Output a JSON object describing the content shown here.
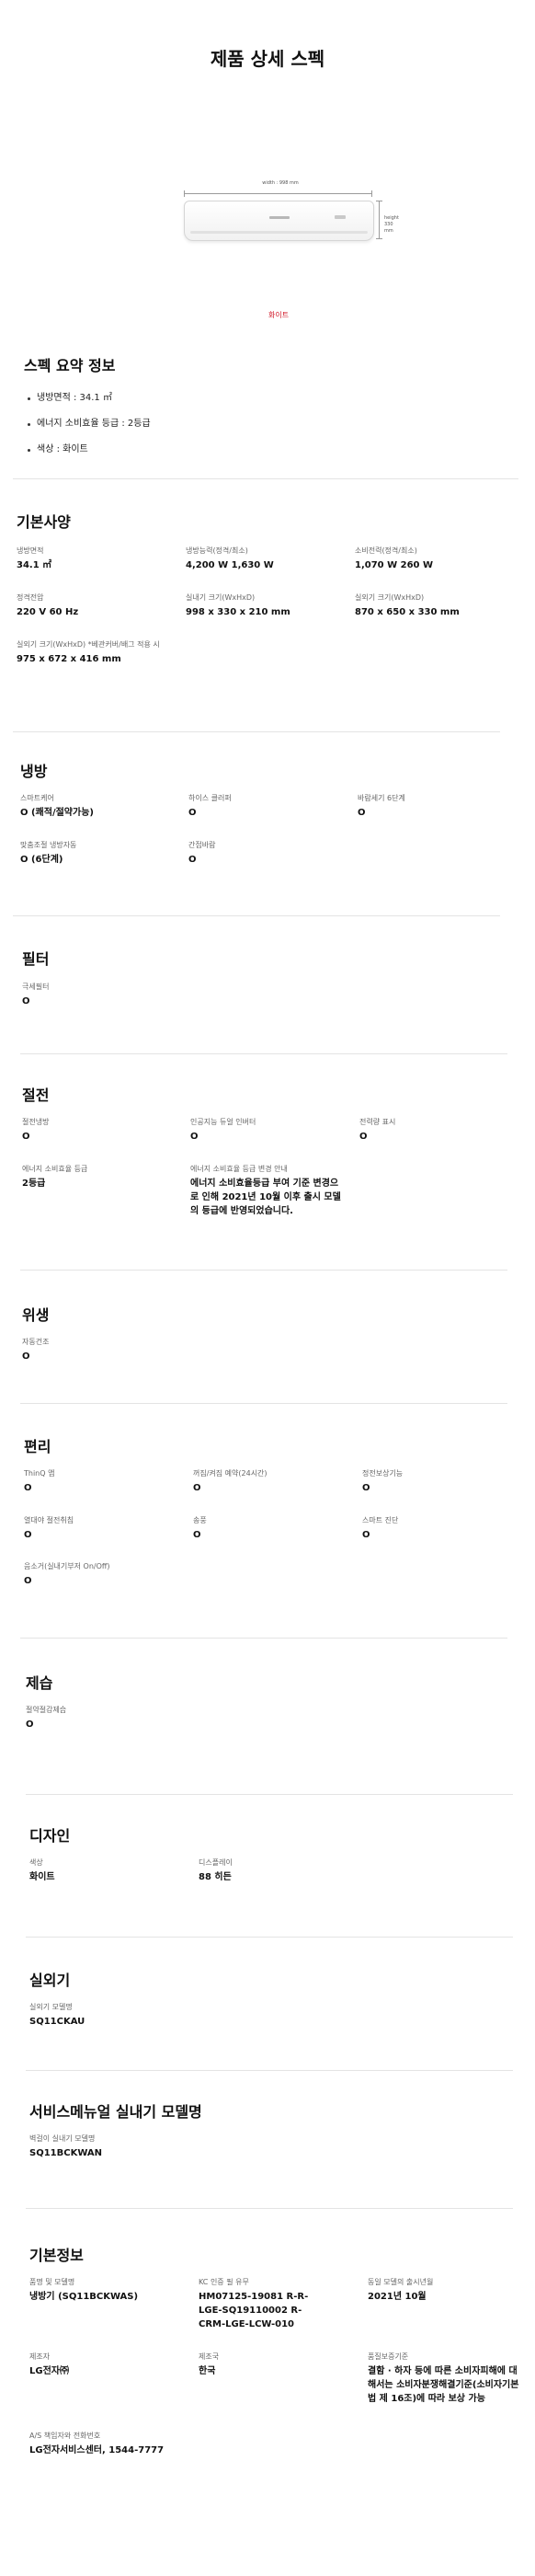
{
  "page_title": "제품 상세 스펙",
  "product_image": {
    "width_label": "width : 998 mm",
    "height_label_1": "height",
    "height_label_2": "330 mm",
    "color_label": "화이트"
  },
  "summary": {
    "title": "스펙 요약 정보",
    "items": [
      "냉방면적 : 34.1 ㎡",
      "에너지 소비효율 등급 : 2등급",
      "색상 : 화이트"
    ]
  },
  "sections": {
    "basic": {
      "title": "기본사양",
      "items": [
        {
          "label": "냉방면적",
          "value": "34.1 ㎡"
        },
        {
          "label": "냉방능력(정격/최소)",
          "value": "4,200 W 1,630 W"
        },
        {
          "label": "소비전력(정격/최소)",
          "value": "1,070 W 260 W"
        },
        {
          "label": "정격전압",
          "value": "220 V 60 Hz"
        },
        {
          "label": "실내기 크기(WxHxD)",
          "value": "998 x 330 x 210 mm"
        },
        {
          "label": "실외기 크기(WxHxD)",
          "value": "870 x 650 x 330 mm"
        },
        {
          "label": "실외기 크기(WxHxD) *베관커버/배그 적용 시",
          "value": "975 x 672 x 416 mm"
        }
      ]
    },
    "cooling": {
      "title": "냉방",
      "items": [
        {
          "label": "스마트케어",
          "value": "O (쾌적/절약가능)"
        },
        {
          "label": "하이스 클러퍼",
          "value": "O"
        },
        {
          "label": "바람세기 6단계",
          "value": "O"
        },
        {
          "label": "맞춤조절 냉방자동",
          "value": "O (6단계)"
        },
        {
          "label": "간접바람",
          "value": "O"
        }
      ]
    },
    "filter": {
      "title": "필터",
      "items": [
        {
          "label": "극세필터",
          "value": "O"
        }
      ]
    },
    "saving": {
      "title": "절전",
      "items": [
        {
          "label": "절전냉방",
          "value": "O"
        },
        {
          "label": "인공지능 듀얼 인버터",
          "value": "O"
        },
        {
          "label": "전력량 표시",
          "value": "O"
        },
        {
          "label": "에너지 소비효율 등급",
          "value": "2등급"
        },
        {
          "label": "에너지 소비효율 등급 변경 안내",
          "value": "에너지 소비효율등급 부여 기준 변경으로 인해 2021년 10월 이후 출시 모델의 등급에 반영되었습니다."
        }
      ]
    },
    "hygiene": {
      "title": "위생",
      "items": [
        {
          "label": "자동건조",
          "value": "O"
        }
      ]
    },
    "convenience": {
      "title": "편리",
      "items": [
        {
          "label": "ThinQ 앱",
          "value": "O"
        },
        {
          "label": "꺼짐/켜짐 예약(24시간)",
          "value": "O"
        },
        {
          "label": "정전보상기능",
          "value": "O"
        },
        {
          "label": "열대야 절전취침",
          "value": "O"
        },
        {
          "label": "송풍",
          "value": "O"
        },
        {
          "label": "스마트 진단",
          "value": "O"
        },
        {
          "label": "음소거(실내기부저 On/Off)",
          "value": "O"
        }
      ]
    },
    "dehumid": {
      "title": "제습",
      "items": [
        {
          "label": "절약절감제습",
          "value": "O"
        }
      ]
    },
    "design": {
      "title": "디자인",
      "items": [
        {
          "label": "색상",
          "value": "화이트"
        },
        {
          "label": "디스플레이",
          "value": "88 히든"
        }
      ]
    },
    "outdoor": {
      "title": "실외기",
      "items": [
        {
          "label": "실외기 모델명",
          "value": "SQ11CKAU"
        }
      ]
    },
    "service": {
      "title": "서비스메뉴얼 실내기 모델명",
      "items": [
        {
          "label": "벽걸이 실내기 모델명",
          "value": "SQ11BCKWAN"
        }
      ]
    },
    "info": {
      "title": "기본정보",
      "items": [
        {
          "label": "품명 및 모델명",
          "value": "냉방기 (SQ11BCKWAS)"
        },
        {
          "label": "KC 인증 필 유무",
          "value": "HM07125-19081 R-R-LGE-SQ19110002 R-CRM-LGE-LCW-010"
        },
        {
          "label": "동일 모델의 출시년월",
          "value": "2021년 10월"
        },
        {
          "label": "제조자",
          "value": "LG전자㈜"
        },
        {
          "label": "제조국",
          "value": "한국"
        },
        {
          "label": "품질보증기준",
          "value": "결함 · 하자 등에 따른 소비자피해에 대해서는 소비자분쟁해결기준(소비자기본법 제 16조)에 따라 보상 가능"
        },
        {
          "label": "A/S 책임자와 전화번호",
          "value": "LG전자서비스센터, 1544-7777"
        }
      ]
    }
  }
}
